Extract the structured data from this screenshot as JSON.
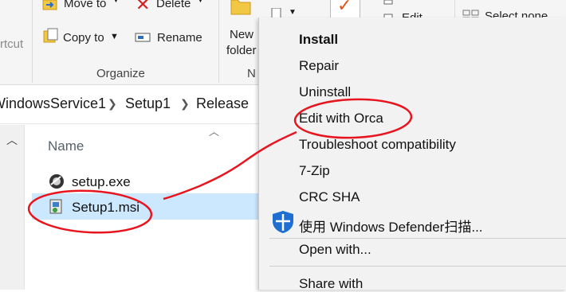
{
  "ribbon": {
    "shortcut_label": "rtcut",
    "move_to_label": "Move to",
    "delete_label": "Delete",
    "copy_to_label": "Copy to",
    "rename_label": "Rename",
    "organize_label": "Organize",
    "new_folder_label_1": "New",
    "new_folder_label_2": "folder",
    "new_group_label_partial": "N",
    "edit_label": "Edit",
    "select_none_label": "Select none"
  },
  "breadcrumb": {
    "items": [
      "WindowsService1",
      "Setup1",
      "Release"
    ]
  },
  "file_list": {
    "column_name": "Name",
    "files": [
      {
        "name": "setup.exe",
        "icon": "setup-exe-icon",
        "selected": false
      },
      {
        "name": "Setup1.msi",
        "icon": "msi-installer-icon",
        "selected": true
      }
    ]
  },
  "context_menu": {
    "items": [
      {
        "label": "Install",
        "bold": true
      },
      {
        "label": "Repair"
      },
      {
        "label": "Uninstall"
      },
      {
        "label": "Edit with Orca"
      },
      {
        "label": "Troubleshoot compatibility"
      },
      {
        "label": "7-Zip"
      },
      {
        "label": "CRC SHA"
      },
      {
        "label": "使用 Windows Defender扫描...",
        "icon": "windows-defender-shield-icon"
      },
      {
        "label": "Open with..."
      },
      {
        "label": "Share with"
      }
    ]
  },
  "colors": {
    "selection_bg": "#cce8ff",
    "annotation_red": "#e8141e",
    "defender_blue": "#1e6fd1",
    "delete_red": "#d42020",
    "folder_yellow": "#f2c744"
  }
}
